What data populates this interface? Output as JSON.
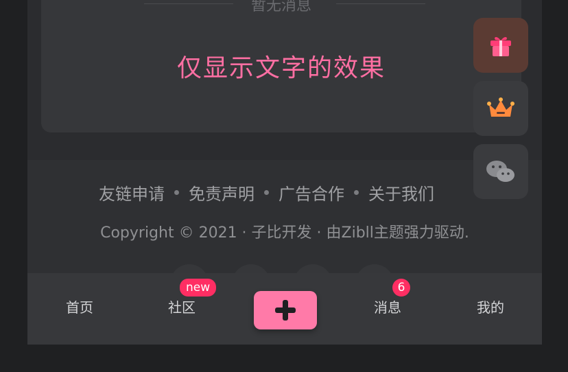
{
  "notice": {
    "empty_text": "暂无消息",
    "headline": "仅显示文字的效果"
  },
  "footer": {
    "links": [
      "友链申请",
      "免责声明",
      "广告合作",
      "关于我们"
    ],
    "copyright": "Copyright © 2021 · 子比开发 · 由Zibll主题强力驱动."
  },
  "tabbar": {
    "tabs": [
      {
        "label": "首页"
      },
      {
        "label": "社区",
        "badge": "new"
      },
      {
        "label": "消息",
        "badge": "6"
      },
      {
        "label": "我的"
      }
    ]
  },
  "floating_buttons": [
    {
      "icon": "gift-icon"
    },
    {
      "icon": "crown-icon"
    },
    {
      "icon": "wechat-icon"
    }
  ],
  "colors": {
    "accent": "#ff6fa3",
    "badge": "#ff2e63",
    "background": "#2b2c2f"
  }
}
